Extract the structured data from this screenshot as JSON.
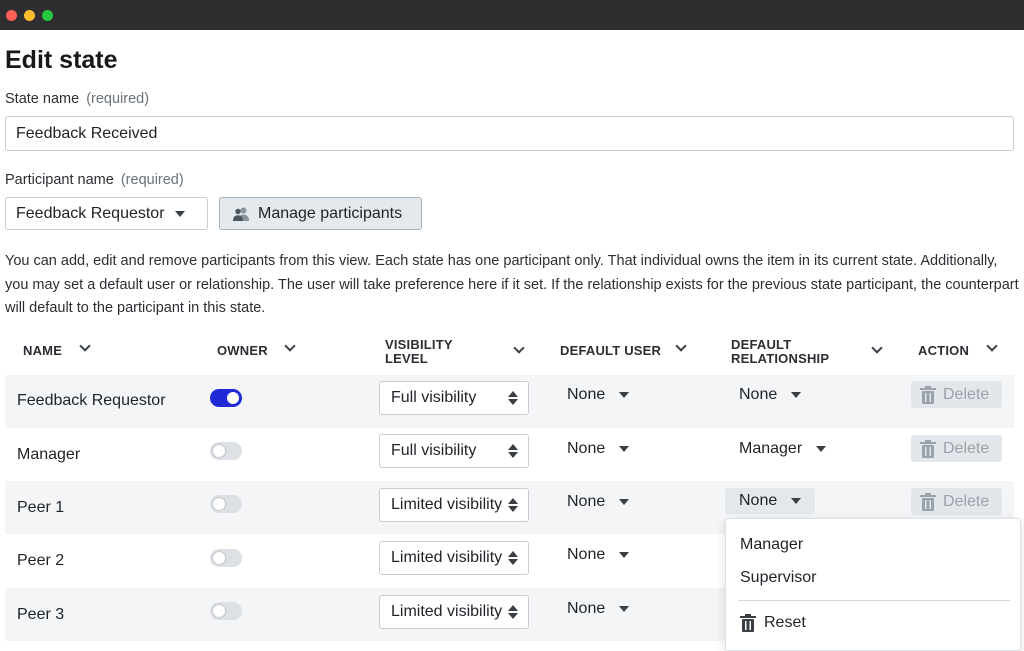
{
  "window": {
    "controls": [
      "close",
      "minimize",
      "zoom"
    ]
  },
  "page": {
    "title": "Edit state"
  },
  "state_name": {
    "label": "State name",
    "required": "(required)",
    "value": "Feedback Received"
  },
  "participant": {
    "label": "Participant name",
    "required": "(required)",
    "selected": "Feedback Requestor",
    "manage_label": "Manage participants",
    "manage_icon": "users-icon"
  },
  "help_text": "You can add, edit and remove participants from this view. Each state has one participant only. That individual owns the item in its current state. Additionally, you may set a default user or relationship. The user will take preference here if it set. If the relationship exists for the previous state participant, the counterpart will default to the participant in this state.",
  "table": {
    "columns": {
      "name": "NAME",
      "owner": "OWNER",
      "visibility_1": "VISIBILITY",
      "visibility_2": "LEVEL",
      "default_user": "DEFAULT USER",
      "relationship_1": "DEFAULT",
      "relationship_2": "RELATIONSHIP",
      "action": "ACTION"
    },
    "rows": [
      {
        "name": "Feedback Requestor",
        "owner": true,
        "visibility": "Full visibility",
        "default_user": "None",
        "relationship": "None",
        "action": "Delete"
      },
      {
        "name": "Manager",
        "owner": false,
        "visibility": "Full visibility",
        "default_user": "None",
        "relationship": "Manager",
        "action": "Delete"
      },
      {
        "name": "Peer 1",
        "owner": false,
        "visibility": "Limited visibility",
        "default_user": "None",
        "relationship": "None",
        "action": "Delete"
      },
      {
        "name": "Peer 2",
        "owner": false,
        "visibility": "Limited visibility",
        "default_user": "None",
        "relationship": "",
        "action": ""
      },
      {
        "name": "Peer 3",
        "owner": false,
        "visibility": "Limited visibility",
        "default_user": "None",
        "relationship": "",
        "action": ""
      }
    ]
  },
  "relationship_menu": {
    "items": [
      "Manager",
      "Supervisor"
    ],
    "reset_label": "Reset",
    "reset_icon": "trash-icon"
  },
  "colors": {
    "toggle_on": "#1f2ad6",
    "titlebar": "#2e2e30",
    "row_shade": "#f3f5f7",
    "button_bg": "#e4e9ee"
  }
}
